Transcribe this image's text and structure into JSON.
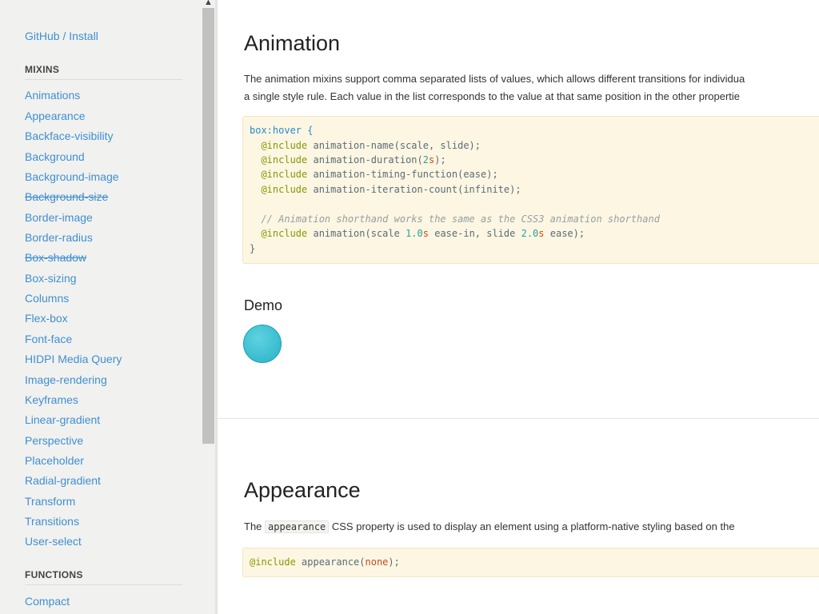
{
  "sidebar": {
    "top_link": "GitHub / Install",
    "mixins_heading": "MIXINS",
    "items": [
      {
        "label": "Animations"
      },
      {
        "label": "Appearance"
      },
      {
        "label": "Backface-visibility"
      },
      {
        "label": "Background"
      },
      {
        "label": "Background-image"
      },
      {
        "label": "Background-size",
        "deprecated": true
      },
      {
        "label": "Border-image"
      },
      {
        "label": "Border-radius"
      },
      {
        "label": "Box-shadow",
        "deprecated": true
      },
      {
        "label": "Box-sizing"
      },
      {
        "label": "Columns"
      },
      {
        "label": "Flex-box"
      },
      {
        "label": "Font-face"
      },
      {
        "label": "HIDPI Media Query"
      },
      {
        "label": "Image-rendering"
      },
      {
        "label": "Keyframes"
      },
      {
        "label": "Linear-gradient"
      },
      {
        "label": "Perspective"
      },
      {
        "label": "Placeholder"
      },
      {
        "label": "Radial-gradient"
      },
      {
        "label": "Transform"
      },
      {
        "label": "Transitions"
      },
      {
        "label": "User-select"
      }
    ],
    "functions_heading": "FUNCTIONS",
    "functions_items": [
      {
        "label": "Compact"
      }
    ],
    "scroll_up_glyph": "▲",
    "link_color": "#3f8fd2"
  },
  "animation": {
    "title": "Animation",
    "desc_line1": "The animation mixins support comma separated lists of values, which allows different transitions for individua",
    "desc_line2": "a single style rule. Each value in the list corresponds to the value at that same position in the other propertie",
    "code": {
      "selector": "box:hover {",
      "lines": [
        {
          "kw": "@include",
          "fn": " animation-name(scale, slide);"
        },
        {
          "kw": "@include",
          "fn": " animation-duration(",
          "num": "2",
          "unit": "s",
          "tail": ");"
        },
        {
          "kw": "@include",
          "fn": " animation-timing-function(ease);"
        },
        {
          "kw": "@include",
          "fn": " animation-iteration-count(infinite);"
        }
      ],
      "comment": "// Animation shorthand works the same as the CSS3 animation shorthand",
      "shorthand": {
        "kw": "@include",
        "a": " animation(scale ",
        "n1": "1.0",
        "u1": "s",
        "b": " ease-in, slide ",
        "n2": "2.0",
        "u2": "s",
        "c": " ease);"
      },
      "close": "}"
    },
    "demo_title": "Demo"
  },
  "appearance": {
    "title": "Appearance",
    "desc_pre": "The ",
    "desc_code": "appearance",
    "desc_post": " CSS property is used to display an element using a platform-native styling based on the",
    "code": {
      "kw": "@include",
      "fn": " appearance(",
      "val": "none",
      "tail": ");"
    }
  }
}
